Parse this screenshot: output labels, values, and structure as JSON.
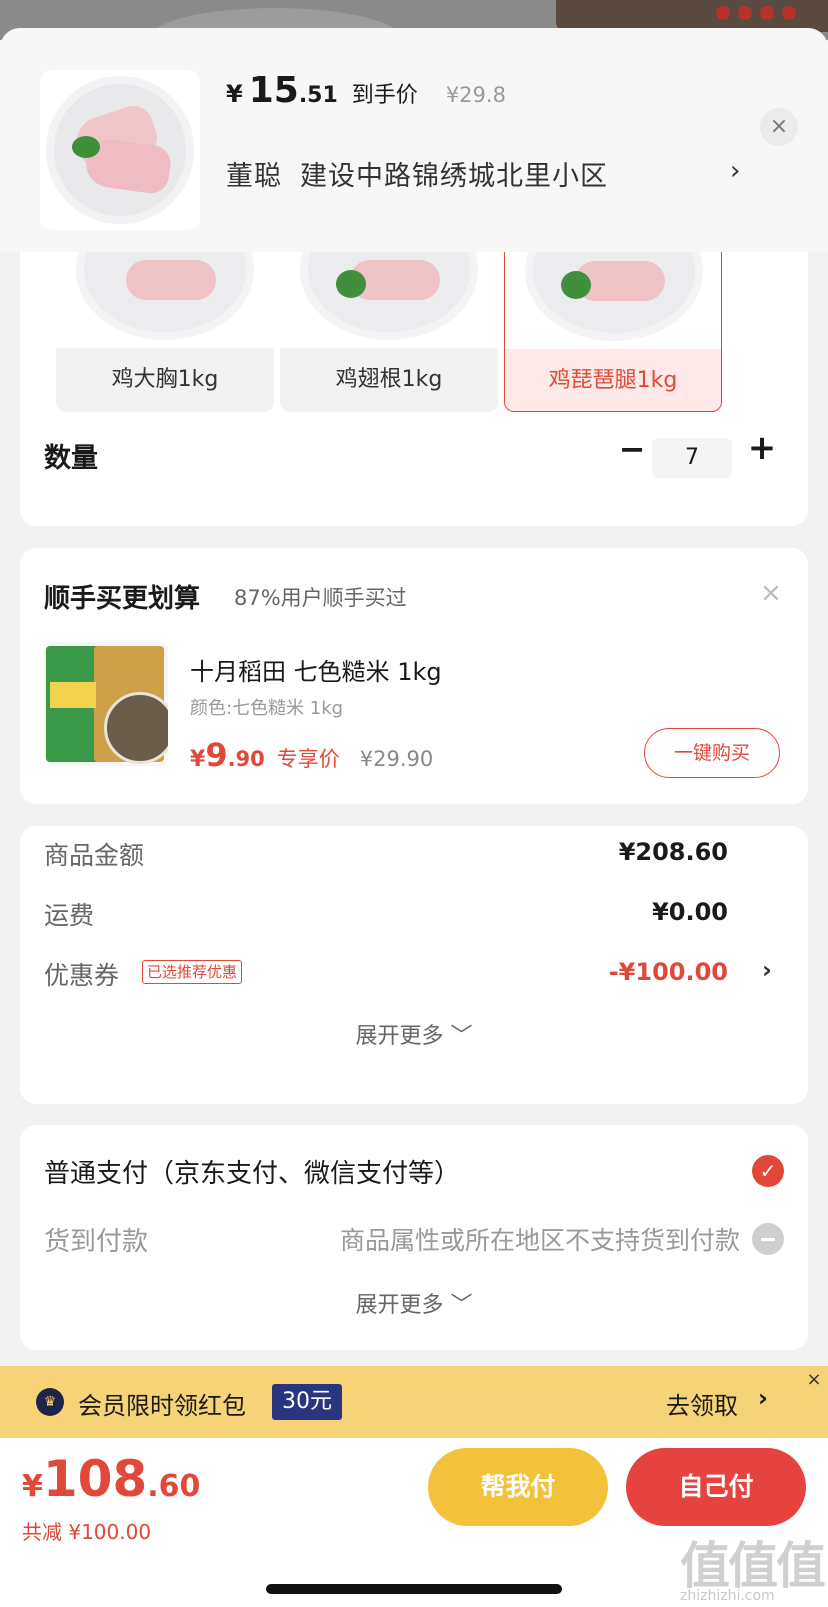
{
  "header": {
    "yen": "¥",
    "price_int": "15",
    "price_dec": ".51",
    "price_tag": "到手价",
    "original_price": "¥29.8",
    "recipient": "董聪",
    "address": "建设中路锦绣城北里小区",
    "chevron": "›",
    "close": "×"
  },
  "specs": {
    "items": [
      {
        "label": "鸡大胸1kg",
        "selected": false
      },
      {
        "label": "鸡翅根1kg",
        "selected": false
      },
      {
        "label": "鸡琵琶腿1kg",
        "selected": true
      }
    ]
  },
  "quantity": {
    "label": "数量",
    "minus": "−",
    "value": "7",
    "plus": "+"
  },
  "combo": {
    "title": "顺手买更划算",
    "subtitle": "87%用户顺手买过",
    "close": "×",
    "product_name": "十月稻田 七色糙米 1kg",
    "product_spec": "颜色:七色糙米 1kg",
    "price_yen": "¥",
    "price_int": "9",
    "price_dec": ".90",
    "price_tag": "专享价",
    "original_price": "¥29.90",
    "buy_label": "一键购买"
  },
  "summary": {
    "goods_label": "商品金额",
    "goods_value": "¥208.60",
    "shipping_label": "运费",
    "shipping_value": "¥0.00",
    "coupon_label": "优惠券",
    "coupon_tag": "已选推荐优惠",
    "coupon_value": "-¥100.00",
    "chevron": "›",
    "expand": "展开更多 ﹀"
  },
  "payment": {
    "normal_label": "普通支付（京东支付、微信支付等）",
    "check": "✓",
    "cod_label": "货到付款",
    "cod_note": "商品属性或所在地区不支持货到付款",
    "expand": "展开更多 ﹀"
  },
  "member": {
    "crown": "♛",
    "text": "会员限时领红包",
    "amount": "30元",
    "get_label": "去领取",
    "chevron": "›",
    "close": "×"
  },
  "bottom": {
    "yen": "¥",
    "total_int": "108",
    "total_dec": ".60",
    "saved": "共减 ¥100.00",
    "help_pay": "帮我付",
    "self_pay": "自己付"
  },
  "watermark": {
    "mark": "值值值",
    "url": "zhizhizhi.com"
  },
  "colors": {
    "accent": "#e0493a",
    "gold": "#f4c13a",
    "member_bg": "#f6d377",
    "navy": "#2a3580"
  }
}
